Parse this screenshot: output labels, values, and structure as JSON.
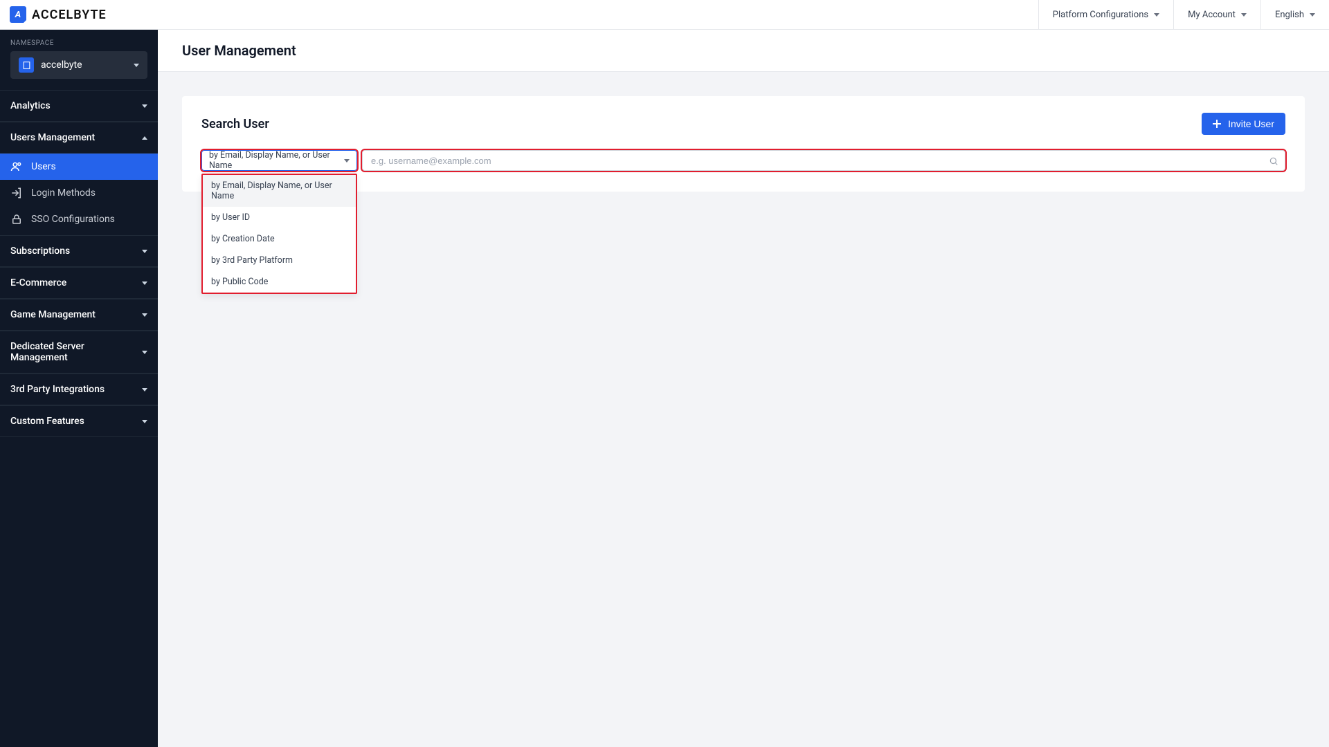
{
  "brand": {
    "mark": "A",
    "name": "ACCELBYTE"
  },
  "header": {
    "platform": "Platform Configurations",
    "account": "My Account",
    "language": "English"
  },
  "sidebar": {
    "namespace_label": "NAMESPACE",
    "namespace_value": "accelbyte",
    "sections": {
      "analytics": "Analytics",
      "users_mgmt": "Users Management",
      "subscriptions": "Subscriptions",
      "ecommerce": "E-Commerce",
      "game_mgmt": "Game Management",
      "dedicated": "Dedicated Server Management",
      "third_party": "3rd Party Integrations",
      "custom": "Custom Features"
    },
    "users_sub": {
      "users": "Users",
      "login": "Login Methods",
      "sso": "SSO Configurations"
    }
  },
  "page": {
    "title": "User Management"
  },
  "card": {
    "title": "Search User",
    "invite_label": "Invite User"
  },
  "search": {
    "select_value": "by Email, Display Name, or User Name",
    "placeholder": "e.g. username@example.com",
    "options": {
      "opt1": "by Email, Display Name, or User Name",
      "opt2": "by User ID",
      "opt3": "by Creation Date",
      "opt4": "by 3rd Party Platform",
      "opt5": "by Public Code"
    }
  }
}
